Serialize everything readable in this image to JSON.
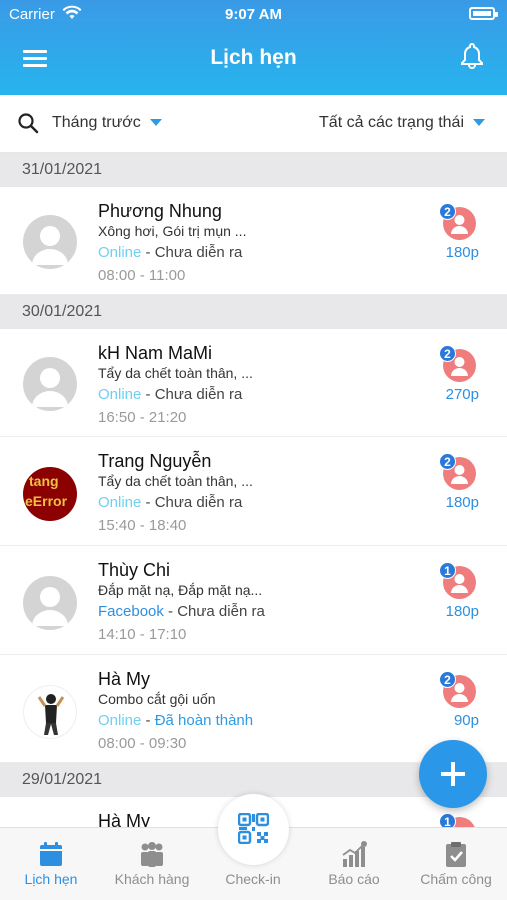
{
  "status_bar": {
    "carrier": "Carrier",
    "time": "9:07 AM"
  },
  "header": {
    "title": "Lịch hẹn"
  },
  "filters": {
    "period": "Tháng trước",
    "status": "Tất cả các trạng thái"
  },
  "groups": [
    {
      "date": "31/01/2021"
    },
    {
      "date": "30/01/2021"
    },
    {
      "date": "29/01/2021"
    }
  ],
  "appointments": [
    {
      "name": "Phương Nhung",
      "services": "Xông hơi, Gói trị mụn ...",
      "source": "Online",
      "status": " - Chưa diễn ra",
      "time": "08:00 - 11:00",
      "staff_count": "2",
      "duration": "180p"
    },
    {
      "name": "kH Nam MaMi",
      "services": "Tẩy da chết toàn thân, ...",
      "source": "Online",
      "status": " - Chưa diễn ra",
      "time": "16:50 - 21:20",
      "staff_count": "2",
      "duration": "270p"
    },
    {
      "name": "Trang Nguyễn",
      "services": "Tẩy da chết toàn thân, ...",
      "source": "Online",
      "status": " - Chưa diễn ra",
      "time": "15:40 - 18:40",
      "staff_count": "2",
      "duration": "180p",
      "avatar_text": "tang eError"
    },
    {
      "name": "Thùy Chi",
      "services": "Đắp mặt nạ, Đắp mặt nạ...",
      "source": "Facebook",
      "status": " - Chưa diễn ra",
      "time": "14:10 - 17:10",
      "staff_count": "1",
      "duration": "180p"
    },
    {
      "name": "Hà My",
      "services": "Combo cắt gội uốn",
      "source": "Online",
      "status_sep": " - ",
      "status": "Đã hoàn thành",
      "time": "08:00 - 09:30",
      "staff_count": "2",
      "duration": "90p"
    },
    {
      "name": "Hà My",
      "staff_count": "1"
    }
  ],
  "tabs": [
    {
      "label": "Lịch hẹn",
      "icon": "calendar-icon"
    },
    {
      "label": "Khách hàng",
      "icon": "customers-icon"
    },
    {
      "label": "Check-in",
      "icon": "qr-icon"
    },
    {
      "label": "Báo cáo",
      "icon": "chart-icon"
    },
    {
      "label": "Chấm công",
      "icon": "clipboard-check-icon"
    }
  ],
  "colors": {
    "accent": "#2d8fe0",
    "header_top": "#3a9ae6",
    "header_bottom": "#27b4ee",
    "online": "#6ed0f3",
    "staff": "#f07d7d"
  }
}
